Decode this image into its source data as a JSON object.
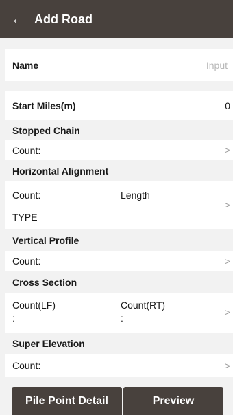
{
  "appbar": {
    "back_icon": "arrow-left-icon",
    "back_glyph": "←",
    "title": "Add Road"
  },
  "name": {
    "label": "Name",
    "placeholder": "Input"
  },
  "start_miles": {
    "label": "Start Miles(m)",
    "value": "0"
  },
  "stopped_chain": {
    "title": "Stopped Chain",
    "count_label": "Count:"
  },
  "horizontal_alignment": {
    "title": "Horizontal Alignment",
    "count_label": "Count:",
    "length_label": "Length",
    "type_label": "TYPE"
  },
  "vertical_profile": {
    "title": "Vertical Profile",
    "count_label": "Count:"
  },
  "cross_section": {
    "title": "Cross Section",
    "count_lf_label": "Count(LF)",
    "count_rt_label": "Count(RT)",
    "colon": ":"
  },
  "super_elevation": {
    "title": "Super Elevation",
    "count_label": "Count:"
  },
  "chevron": ">",
  "buttons": {
    "pile_point_detail": "Pile Point Detail",
    "preview": "Preview"
  },
  "colors": {
    "appbar": "#48413d",
    "background": "#f2f2f2"
  }
}
